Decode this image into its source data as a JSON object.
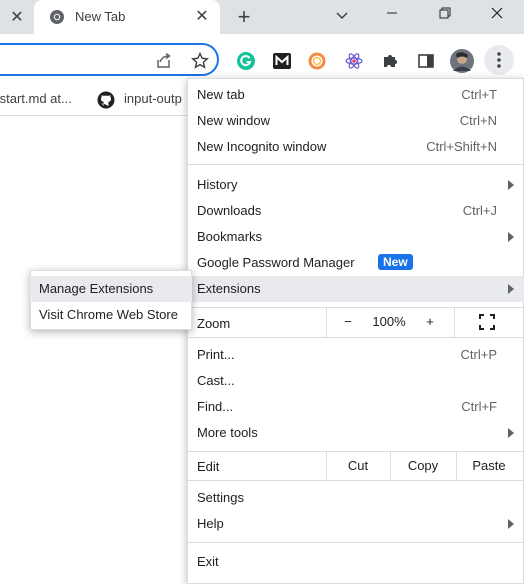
{
  "tabs": {
    "active_title": "New Tab"
  },
  "bookmarks": {
    "item1": "/start.md at...",
    "item2": "input-outp"
  },
  "menu": {
    "new_tab": {
      "label": "New tab",
      "shortcut": "Ctrl+T"
    },
    "new_window": {
      "label": "New window",
      "shortcut": "Ctrl+N"
    },
    "new_incognito": {
      "label": "New Incognito window",
      "shortcut": "Ctrl+Shift+N"
    },
    "history": {
      "label": "History"
    },
    "downloads": {
      "label": "Downloads",
      "shortcut": "Ctrl+J"
    },
    "bookmarks": {
      "label": "Bookmarks"
    },
    "password_manager": {
      "label": "Google Password Manager",
      "badge": "New"
    },
    "extensions": {
      "label": "Extensions"
    },
    "zoom": {
      "label": "Zoom",
      "minus": "−",
      "level": "100%",
      "plus": "+"
    },
    "print": {
      "label": "Print...",
      "shortcut": "Ctrl+P"
    },
    "cast": {
      "label": "Cast..."
    },
    "find": {
      "label": "Find...",
      "shortcut": "Ctrl+F"
    },
    "more_tools": {
      "label": "More tools"
    },
    "edit": {
      "label": "Edit",
      "cut": "Cut",
      "copy": "Copy",
      "paste": "Paste"
    },
    "settings": {
      "label": "Settings"
    },
    "help": {
      "label": "Help"
    },
    "exit": {
      "label": "Exit"
    }
  },
  "submenu": {
    "manage_extensions": "Manage Extensions",
    "visit_store": "Visit Chrome Web Store"
  },
  "colors": {
    "accent": "#1a73e8",
    "highlight": "#e8eaed",
    "titlebar": "#dee1e6"
  }
}
